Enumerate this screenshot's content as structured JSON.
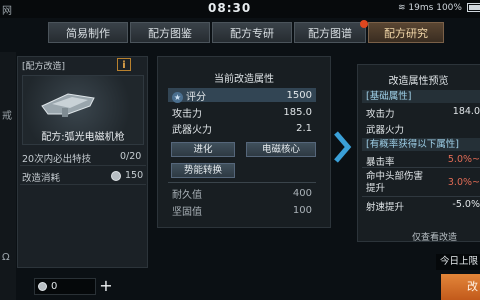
{
  "status_bar": {
    "network": "网",
    "time": "08:30",
    "speed": "19ms",
    "battery": "100%"
  },
  "tabs": [
    {
      "label": "简易制作",
      "active": false
    },
    {
      "label": "配方图鉴",
      "active": false
    },
    {
      "label": "配方专研",
      "active": false
    },
    {
      "label": "配方图谱",
      "active": false,
      "badge": true
    },
    {
      "label": "配方研究",
      "active": true
    }
  ],
  "left_strip": {
    "glyph1": "戒",
    "glyph2": "Ω"
  },
  "left_panel": {
    "header": "[配方改造]",
    "info_icon": "i",
    "item_name": "配方:弧光电磁机枪",
    "guarantee_label": "20次内必出特技",
    "guarantee_value": "0/20",
    "cost_label": "改造消耗",
    "cost_value": "150"
  },
  "bottom": {
    "currency_value": "0",
    "plus": "+"
  },
  "current": {
    "title": "当前改造属性",
    "rating_label": "评分",
    "rating_value": "1500",
    "attack_label": "攻击力",
    "attack_value": "185.0",
    "firepower_label": "武器火力",
    "firepower_value": "2.1",
    "btn_evolve": "进化",
    "btn_core": "电磁核心",
    "btn_energy": "势能转换",
    "durability_label": "耐久值",
    "durability_value": "400",
    "sturdiness_label": "坚固值",
    "sturdiness_value": "100"
  },
  "preview": {
    "title": "改造属性预览",
    "base_section": "[基础属性]",
    "attack_label": "攻击力",
    "attack_value": "184.0",
    "firepower_label": "武器火力",
    "chance_section": "[有概率获得以下属性]",
    "crit_label": "暴击率",
    "crit_value": "5.0%~",
    "head_label": "命中头部伤害提升",
    "head_value": "3.0%~",
    "rof_label": "射速提升",
    "rof_value": "-5.0%",
    "note": "仅查看改造"
  },
  "daily_tag": "今日上限",
  "modify_button": "改"
}
